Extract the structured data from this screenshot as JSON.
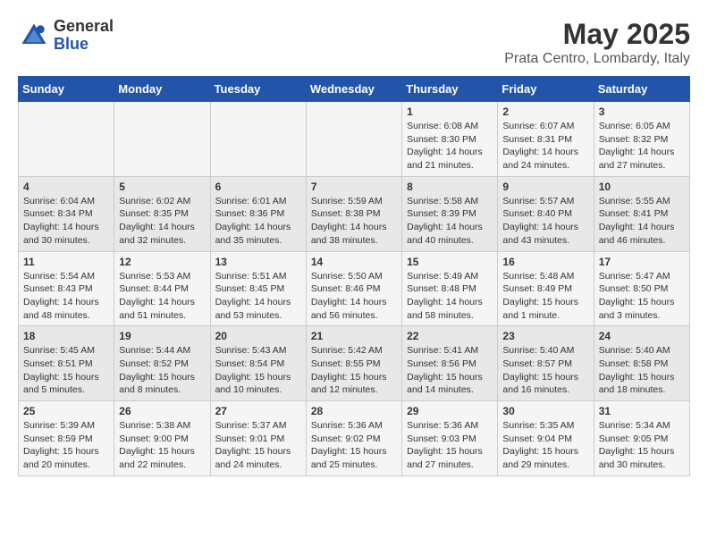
{
  "header": {
    "logo_general": "General",
    "logo_blue": "Blue",
    "month_title": "May 2025",
    "location": "Prata Centro, Lombardy, Italy"
  },
  "days_of_week": [
    "Sunday",
    "Monday",
    "Tuesday",
    "Wednesday",
    "Thursday",
    "Friday",
    "Saturday"
  ],
  "weeks": [
    [
      {
        "day": "",
        "content": ""
      },
      {
        "day": "",
        "content": ""
      },
      {
        "day": "",
        "content": ""
      },
      {
        "day": "",
        "content": ""
      },
      {
        "day": "1",
        "content": "Sunrise: 6:08 AM\nSunset: 8:30 PM\nDaylight: 14 hours and 21 minutes."
      },
      {
        "day": "2",
        "content": "Sunrise: 6:07 AM\nSunset: 8:31 PM\nDaylight: 14 hours and 24 minutes."
      },
      {
        "day": "3",
        "content": "Sunrise: 6:05 AM\nSunset: 8:32 PM\nDaylight: 14 hours and 27 minutes."
      }
    ],
    [
      {
        "day": "4",
        "content": "Sunrise: 6:04 AM\nSunset: 8:34 PM\nDaylight: 14 hours and 30 minutes."
      },
      {
        "day": "5",
        "content": "Sunrise: 6:02 AM\nSunset: 8:35 PM\nDaylight: 14 hours and 32 minutes."
      },
      {
        "day": "6",
        "content": "Sunrise: 6:01 AM\nSunset: 8:36 PM\nDaylight: 14 hours and 35 minutes."
      },
      {
        "day": "7",
        "content": "Sunrise: 5:59 AM\nSunset: 8:38 PM\nDaylight: 14 hours and 38 minutes."
      },
      {
        "day": "8",
        "content": "Sunrise: 5:58 AM\nSunset: 8:39 PM\nDaylight: 14 hours and 40 minutes."
      },
      {
        "day": "9",
        "content": "Sunrise: 5:57 AM\nSunset: 8:40 PM\nDaylight: 14 hours and 43 minutes."
      },
      {
        "day": "10",
        "content": "Sunrise: 5:55 AM\nSunset: 8:41 PM\nDaylight: 14 hours and 46 minutes."
      }
    ],
    [
      {
        "day": "11",
        "content": "Sunrise: 5:54 AM\nSunset: 8:43 PM\nDaylight: 14 hours and 48 minutes."
      },
      {
        "day": "12",
        "content": "Sunrise: 5:53 AM\nSunset: 8:44 PM\nDaylight: 14 hours and 51 minutes."
      },
      {
        "day": "13",
        "content": "Sunrise: 5:51 AM\nSunset: 8:45 PM\nDaylight: 14 hours and 53 minutes."
      },
      {
        "day": "14",
        "content": "Sunrise: 5:50 AM\nSunset: 8:46 PM\nDaylight: 14 hours and 56 minutes."
      },
      {
        "day": "15",
        "content": "Sunrise: 5:49 AM\nSunset: 8:48 PM\nDaylight: 14 hours and 58 minutes."
      },
      {
        "day": "16",
        "content": "Sunrise: 5:48 AM\nSunset: 8:49 PM\nDaylight: 15 hours and 1 minute."
      },
      {
        "day": "17",
        "content": "Sunrise: 5:47 AM\nSunset: 8:50 PM\nDaylight: 15 hours and 3 minutes."
      }
    ],
    [
      {
        "day": "18",
        "content": "Sunrise: 5:45 AM\nSunset: 8:51 PM\nDaylight: 15 hours and 5 minutes."
      },
      {
        "day": "19",
        "content": "Sunrise: 5:44 AM\nSunset: 8:52 PM\nDaylight: 15 hours and 8 minutes."
      },
      {
        "day": "20",
        "content": "Sunrise: 5:43 AM\nSunset: 8:54 PM\nDaylight: 15 hours and 10 minutes."
      },
      {
        "day": "21",
        "content": "Sunrise: 5:42 AM\nSunset: 8:55 PM\nDaylight: 15 hours and 12 minutes."
      },
      {
        "day": "22",
        "content": "Sunrise: 5:41 AM\nSunset: 8:56 PM\nDaylight: 15 hours and 14 minutes."
      },
      {
        "day": "23",
        "content": "Sunrise: 5:40 AM\nSunset: 8:57 PM\nDaylight: 15 hours and 16 minutes."
      },
      {
        "day": "24",
        "content": "Sunrise: 5:40 AM\nSunset: 8:58 PM\nDaylight: 15 hours and 18 minutes."
      }
    ],
    [
      {
        "day": "25",
        "content": "Sunrise: 5:39 AM\nSunset: 8:59 PM\nDaylight: 15 hours and 20 minutes."
      },
      {
        "day": "26",
        "content": "Sunrise: 5:38 AM\nSunset: 9:00 PM\nDaylight: 15 hours and 22 minutes."
      },
      {
        "day": "27",
        "content": "Sunrise: 5:37 AM\nSunset: 9:01 PM\nDaylight: 15 hours and 24 minutes."
      },
      {
        "day": "28",
        "content": "Sunrise: 5:36 AM\nSunset: 9:02 PM\nDaylight: 15 hours and 25 minutes."
      },
      {
        "day": "29",
        "content": "Sunrise: 5:36 AM\nSunset: 9:03 PM\nDaylight: 15 hours and 27 minutes."
      },
      {
        "day": "30",
        "content": "Sunrise: 5:35 AM\nSunset: 9:04 PM\nDaylight: 15 hours and 29 minutes."
      },
      {
        "day": "31",
        "content": "Sunrise: 5:34 AM\nSunset: 9:05 PM\nDaylight: 15 hours and 30 minutes."
      }
    ]
  ]
}
